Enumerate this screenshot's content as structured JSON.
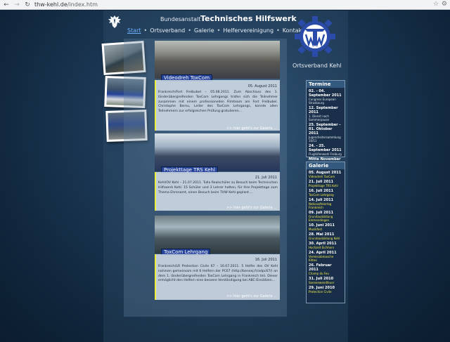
{
  "browser": {
    "url_host": "thw-kehl.de",
    "url_path": "/index.htm"
  },
  "header": {
    "bundesanstalt": "Bundesanstalt",
    "title": "Technisches Hilfswerk",
    "menu": [
      "Start",
      "Ortsverband",
      "Galerie",
      "Helfervereinigung",
      "Kontakt"
    ],
    "ortsverband": "Ortsverband Kehl"
  },
  "articles": [
    {
      "tag": "Videodreh ToxCom",
      "date": "05. August 2011",
      "text": "Frankreich/Fort Frelbubel – 05.08.2011. Zum Abschluss des 1. länderübergreifenden ToxCom Lehrgangs trafen sich die Teilnehmer zusammen mit einem professionellen Filmteam am Fort Frelbubel. Christophe Bernu, Leiter des ToxCom Lehrgangs, konnte allen Teilnehmern zur erfolgreichen Prüfung gratulieren...",
      "more": ">> hier geht's zur Galerie ..."
    },
    {
      "tag": "Projekttage TRS Kehl",
      "date": "21. Juli 2011",
      "text": "Kehl/OV Kehl – 21.07.2011. Tulla Realschüler zu Besuch beim Technischen Hilfswerk Kehl. 15 Schüler und 3 Lehrer hatten, für Ihre Projekttage zum Thema Ehrenamt, einen Besuch beim THW Kehl geplant....",
      "more": ">> hier geht's zur Galerie ..."
    },
    {
      "tag": "ToxCom Lehrgang",
      "date": "16. Juli 2011",
      "text": "Frankreich/LR Protection Civile 67 – 16.07.2011. 5 Helfer des OV Kehl nahmen gemeinsam mit 6 Helfern der PC67 (http://benoej.fr/adpc67/) an dem 1. länderübergreifenden ToxCom Lehrgang in Frankreich teil. Dieser ermöglicht den Helfern eine bessere Verständigung bei ABC-Einsätzen...",
      "more": ">> hier geht's zur Galerie ..."
    }
  ],
  "termine": {
    "title": "Termine",
    "items": [
      {
        "date": "02. - 04. September 2011",
        "text": "Congress European Strasbourg"
      },
      {
        "date": "12. September 2011",
        "text": "1. Dienst nach Sommerpause"
      },
      {
        "date": "25. September - 01. Oktober 2011",
        "text": "Jugendreitersammlung 10/11"
      },
      {
        "date": "24. - 25. September 2011",
        "text": "Flughäfenwahl Freiburg"
      },
      {
        "date": "Mitte November 2011",
        "text": "2 Tage Sprechfunkausbildung"
      }
    ]
  },
  "galerie": {
    "title": "Galerie",
    "items": [
      {
        "date": "05. August 2011",
        "text": "Videodreh ToxCom"
      },
      {
        "date": "21. Juli 2011",
        "text": "Projekttage TRS Kehl"
      },
      {
        "date": "16. Juli 2011",
        "text": "ToxCom Lehrgang"
      },
      {
        "date": "14. Juli 2011",
        "text": "Nationalfeiertag Frankreich"
      },
      {
        "date": "09. Juli 2011",
        "text": "Grundausbildung Emmendingen"
      },
      {
        "date": "10. Juni 2011",
        "text": "Musikfest"
      },
      {
        "date": "28. Mai 2011",
        "text": "Grundausbildung Kehl"
      },
      {
        "date": "30. April 2011",
        "text": "Hochzeit Eichhorn"
      },
      {
        "date": "24. April 2011",
        "text": "Vereinsabmasche Kittee"
      },
      {
        "date": "26. Februar 2011",
        "text": "Champ du Feu"
      },
      {
        "date": "31. Juli 2010",
        "text": "Sonnenwendfeuer"
      },
      {
        "date": "29. Juni 2010",
        "text": "Protection Civile"
      }
    ]
  }
}
